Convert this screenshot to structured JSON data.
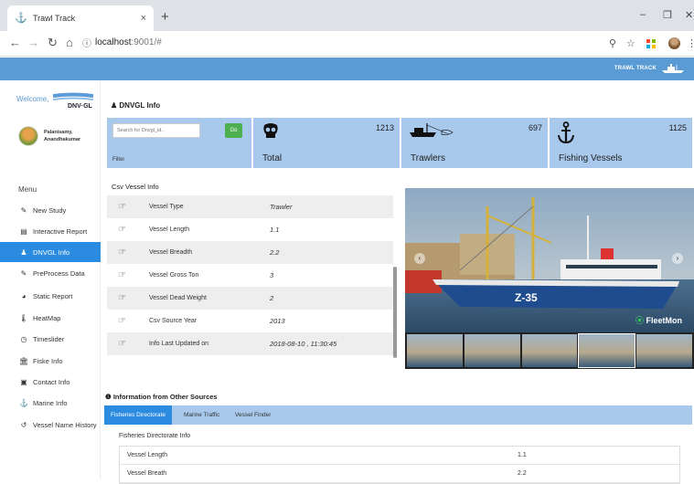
{
  "browser": {
    "tab_title": "Trawl Track",
    "tab_close": "×",
    "new_tab": "+",
    "url_host": "localhost",
    "url_path": ":9001/#",
    "win_min": "–",
    "win_max": "❐",
    "win_close": "✕"
  },
  "header": {
    "brand": "TRAWL TRACK"
  },
  "sidebar": {
    "welcome": "Welcome,",
    "logo_text": "DNV·GL",
    "user_name_line1": "Palanisamy,",
    "user_name_line2": "Anandhakumar",
    "menu_title": "Menu",
    "items": [
      {
        "label": "New Study",
        "icon": "edit-icon"
      },
      {
        "label": "Interactive Report",
        "icon": "chart-icon"
      },
      {
        "label": "DNVGL Info",
        "icon": "user-icon",
        "active": true
      },
      {
        "label": "PreProcess Data",
        "icon": "edit-icon"
      },
      {
        "label": "Static Report",
        "icon": "pie-icon"
      },
      {
        "label": "HeatMap",
        "icon": "thermometer-icon"
      },
      {
        "label": "Timeslider",
        "icon": "clock-icon"
      },
      {
        "label": "Fiske Info",
        "icon": "bank-icon"
      },
      {
        "label": "Contact Info",
        "icon": "contact-icon"
      },
      {
        "label": "Marine Info",
        "icon": "anchor-icon"
      },
      {
        "label": "Vessel Name History",
        "icon": "history-icon"
      }
    ]
  },
  "main": {
    "section_title": "DNVGL Info",
    "search_placeholder": "Search for Dnvgl_id..",
    "go_label": "Go",
    "filter_label": "Filter",
    "stats": [
      {
        "label": "Total",
        "count": "1213",
        "icon": "total-icon"
      },
      {
        "label": "Trawlers",
        "count": "697",
        "icon": "trawler-icon"
      },
      {
        "label": "Fishing Vessels",
        "count": "1125",
        "icon": "anchor-icon"
      }
    ],
    "csv_title": "Csv Vessel Info",
    "vessel_rows": [
      {
        "label": "Vessel Type",
        "value": "Trawler"
      },
      {
        "label": "Vessel Length",
        "value": "1.1"
      },
      {
        "label": "Vessel Breadth",
        "value": "2.2"
      },
      {
        "label": "Vessel Gross Ton",
        "value": "3"
      },
      {
        "label": "Vessel Dead Weight",
        "value": "2"
      },
      {
        "label": "Csv Source Year",
        "value": "2013"
      },
      {
        "label": "Info Last Updated on",
        "value": "2018-08-10 , 11:30:45"
      }
    ],
    "photo_watermark_prefix": "⦿",
    "photo_watermark": "FleetMon",
    "ship_name": "Z-35",
    "other_sources_title": "Information from Other Sources",
    "other_tabs": [
      {
        "label": "Fisheries Directorate",
        "active": true
      },
      {
        "label": "Marine Traffic"
      },
      {
        "label": "Vessel Finder"
      }
    ],
    "fd_title": "Fisheries Directorate Info",
    "fd_rows": [
      {
        "label": "Vessel Length",
        "value": "1.1"
      },
      {
        "label": "Vessel Breath",
        "value": "2.2"
      }
    ]
  }
}
